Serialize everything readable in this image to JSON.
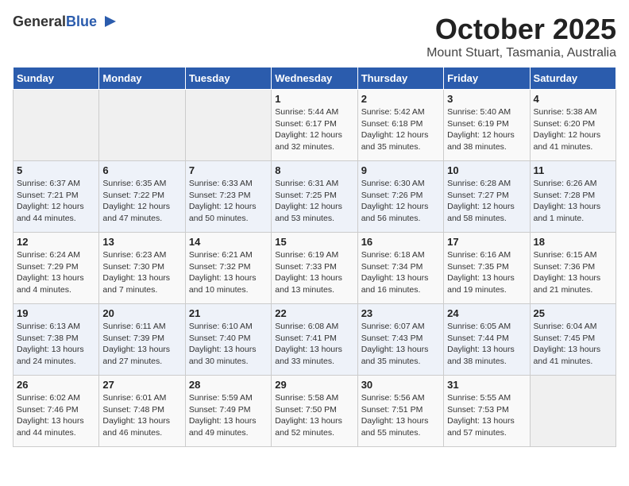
{
  "header": {
    "logo_general": "General",
    "logo_blue": "Blue",
    "title": "October 2025",
    "subtitle": "Mount Stuart, Tasmania, Australia"
  },
  "days_of_week": [
    "Sunday",
    "Monday",
    "Tuesday",
    "Wednesday",
    "Thursday",
    "Friday",
    "Saturday"
  ],
  "weeks": [
    [
      {
        "day": "",
        "info": ""
      },
      {
        "day": "",
        "info": ""
      },
      {
        "day": "",
        "info": ""
      },
      {
        "day": "1",
        "info": "Sunrise: 5:44 AM\nSunset: 6:17 PM\nDaylight: 12 hours\nand 32 minutes."
      },
      {
        "day": "2",
        "info": "Sunrise: 5:42 AM\nSunset: 6:18 PM\nDaylight: 12 hours\nand 35 minutes."
      },
      {
        "day": "3",
        "info": "Sunrise: 5:40 AM\nSunset: 6:19 PM\nDaylight: 12 hours\nand 38 minutes."
      },
      {
        "day": "4",
        "info": "Sunrise: 5:38 AM\nSunset: 6:20 PM\nDaylight: 12 hours\nand 41 minutes."
      }
    ],
    [
      {
        "day": "5",
        "info": "Sunrise: 6:37 AM\nSunset: 7:21 PM\nDaylight: 12 hours\nand 44 minutes."
      },
      {
        "day": "6",
        "info": "Sunrise: 6:35 AM\nSunset: 7:22 PM\nDaylight: 12 hours\nand 47 minutes."
      },
      {
        "day": "7",
        "info": "Sunrise: 6:33 AM\nSunset: 7:23 PM\nDaylight: 12 hours\nand 50 minutes."
      },
      {
        "day": "8",
        "info": "Sunrise: 6:31 AM\nSunset: 7:25 PM\nDaylight: 12 hours\nand 53 minutes."
      },
      {
        "day": "9",
        "info": "Sunrise: 6:30 AM\nSunset: 7:26 PM\nDaylight: 12 hours\nand 56 minutes."
      },
      {
        "day": "10",
        "info": "Sunrise: 6:28 AM\nSunset: 7:27 PM\nDaylight: 12 hours\nand 58 minutes."
      },
      {
        "day": "11",
        "info": "Sunrise: 6:26 AM\nSunset: 7:28 PM\nDaylight: 13 hours\nand 1 minute."
      }
    ],
    [
      {
        "day": "12",
        "info": "Sunrise: 6:24 AM\nSunset: 7:29 PM\nDaylight: 13 hours\nand 4 minutes."
      },
      {
        "day": "13",
        "info": "Sunrise: 6:23 AM\nSunset: 7:30 PM\nDaylight: 13 hours\nand 7 minutes."
      },
      {
        "day": "14",
        "info": "Sunrise: 6:21 AM\nSunset: 7:32 PM\nDaylight: 13 hours\nand 10 minutes."
      },
      {
        "day": "15",
        "info": "Sunrise: 6:19 AM\nSunset: 7:33 PM\nDaylight: 13 hours\nand 13 minutes."
      },
      {
        "day": "16",
        "info": "Sunrise: 6:18 AM\nSunset: 7:34 PM\nDaylight: 13 hours\nand 16 minutes."
      },
      {
        "day": "17",
        "info": "Sunrise: 6:16 AM\nSunset: 7:35 PM\nDaylight: 13 hours\nand 19 minutes."
      },
      {
        "day": "18",
        "info": "Sunrise: 6:15 AM\nSunset: 7:36 PM\nDaylight: 13 hours\nand 21 minutes."
      }
    ],
    [
      {
        "day": "19",
        "info": "Sunrise: 6:13 AM\nSunset: 7:38 PM\nDaylight: 13 hours\nand 24 minutes."
      },
      {
        "day": "20",
        "info": "Sunrise: 6:11 AM\nSunset: 7:39 PM\nDaylight: 13 hours\nand 27 minutes."
      },
      {
        "day": "21",
        "info": "Sunrise: 6:10 AM\nSunset: 7:40 PM\nDaylight: 13 hours\nand 30 minutes."
      },
      {
        "day": "22",
        "info": "Sunrise: 6:08 AM\nSunset: 7:41 PM\nDaylight: 13 hours\nand 33 minutes."
      },
      {
        "day": "23",
        "info": "Sunrise: 6:07 AM\nSunset: 7:43 PM\nDaylight: 13 hours\nand 35 minutes."
      },
      {
        "day": "24",
        "info": "Sunrise: 6:05 AM\nSunset: 7:44 PM\nDaylight: 13 hours\nand 38 minutes."
      },
      {
        "day": "25",
        "info": "Sunrise: 6:04 AM\nSunset: 7:45 PM\nDaylight: 13 hours\nand 41 minutes."
      }
    ],
    [
      {
        "day": "26",
        "info": "Sunrise: 6:02 AM\nSunset: 7:46 PM\nDaylight: 13 hours\nand 44 minutes."
      },
      {
        "day": "27",
        "info": "Sunrise: 6:01 AM\nSunset: 7:48 PM\nDaylight: 13 hours\nand 46 minutes."
      },
      {
        "day": "28",
        "info": "Sunrise: 5:59 AM\nSunset: 7:49 PM\nDaylight: 13 hours\nand 49 minutes."
      },
      {
        "day": "29",
        "info": "Sunrise: 5:58 AM\nSunset: 7:50 PM\nDaylight: 13 hours\nand 52 minutes."
      },
      {
        "day": "30",
        "info": "Sunrise: 5:56 AM\nSunset: 7:51 PM\nDaylight: 13 hours\nand 55 minutes."
      },
      {
        "day": "31",
        "info": "Sunrise: 5:55 AM\nSunset: 7:53 PM\nDaylight: 13 hours\nand 57 minutes."
      },
      {
        "day": "",
        "info": ""
      }
    ]
  ]
}
